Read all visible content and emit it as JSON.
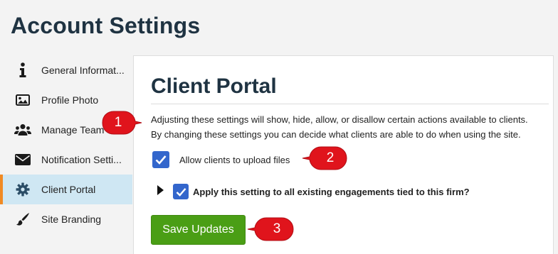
{
  "page": {
    "title": "Account Settings"
  },
  "sidebar": {
    "items": [
      {
        "label": "General Informat...",
        "icon": "info-icon"
      },
      {
        "label": "Profile Photo",
        "icon": "image-icon"
      },
      {
        "label": "Manage Team",
        "icon": "users-icon"
      },
      {
        "label": "Notification Setti...",
        "icon": "envelope-icon"
      },
      {
        "label": "Client Portal",
        "icon": "gear-icon",
        "active": true
      },
      {
        "label": "Site Branding",
        "icon": "paintbrush-icon"
      }
    ]
  },
  "panel": {
    "title": "Client Portal",
    "description_line1": "Adjusting these settings will show, hide, allow, or disallow certain actions available to clients.",
    "description_line2": "By changing these settings you can decide what clients are able to do when using the site.",
    "allow_upload": {
      "label": "Allow clients to upload files",
      "checked": true
    },
    "apply_all": {
      "label": "Apply this setting to all existing engagements tied to this firm?",
      "checked": true
    },
    "save_label": "Save Updates"
  },
  "callouts": [
    "1",
    "2",
    "3"
  ],
  "colors": {
    "accent_orange": "#f08a24",
    "active_bg": "#cfe7f3",
    "checkbox_blue": "#3366cc",
    "save_green": "#4a9e15",
    "callout_red": "#e0141c",
    "title_dark": "#1f3342"
  }
}
